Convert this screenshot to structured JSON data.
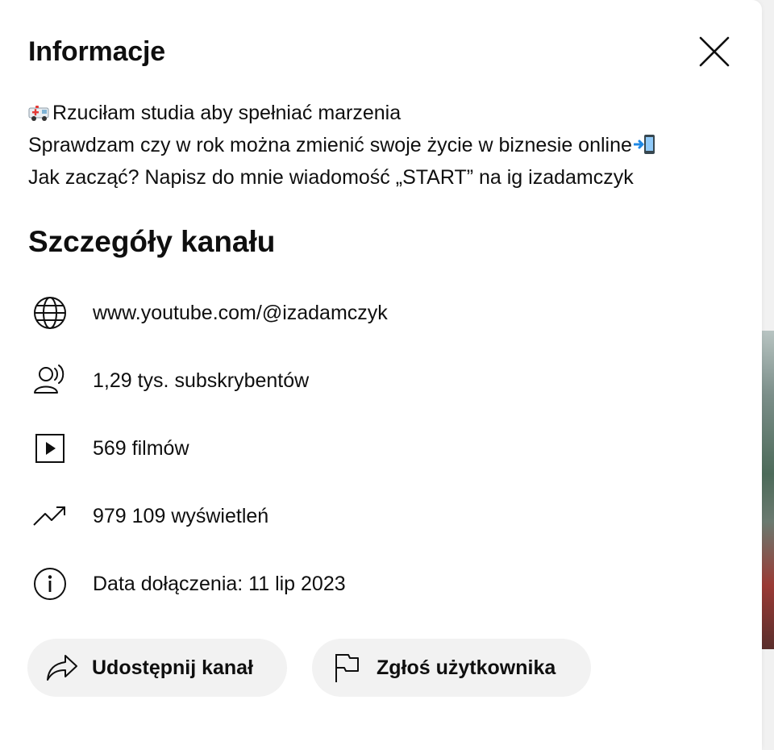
{
  "dialog": {
    "title": "Informacje",
    "close_icon": "close-icon"
  },
  "description": {
    "line1": "Rzuciłam studia aby spełniać marzenia",
    "line1_emoji": "ambulance-emoji",
    "line2": "Sprawdzam czy w rok można zmienić swoje życie w biznesie online",
    "line2_emoji": "mobile-phone-arrow-emoji",
    "line3": "Jak zacząć? Napisz do mnie wiadomość „START” na ig izadamczyk"
  },
  "details": {
    "title": "Szczegóły kanału",
    "items": [
      {
        "icon": "globe-icon",
        "text": "www.youtube.com/@izadamczyk"
      },
      {
        "icon": "subscribers-icon",
        "text": "1,29 tys. subskrybentów"
      },
      {
        "icon": "video-icon",
        "text": "569 filmów"
      },
      {
        "icon": "trending-icon",
        "text": "979 109 wyświetleń"
      },
      {
        "icon": "info-icon",
        "text": "Data dołączenia: 11 lip 2023"
      }
    ]
  },
  "actions": {
    "share": {
      "icon": "share-icon",
      "label": "Udostępnij kanał"
    },
    "report": {
      "icon": "flag-icon",
      "label": "Zgłoś użytkownika"
    }
  },
  "colors": {
    "text": "#0f0f0f",
    "button_bg": "#f2f2f2",
    "dialog_bg": "#ffffff",
    "backdrop": "#f1f1f1"
  }
}
